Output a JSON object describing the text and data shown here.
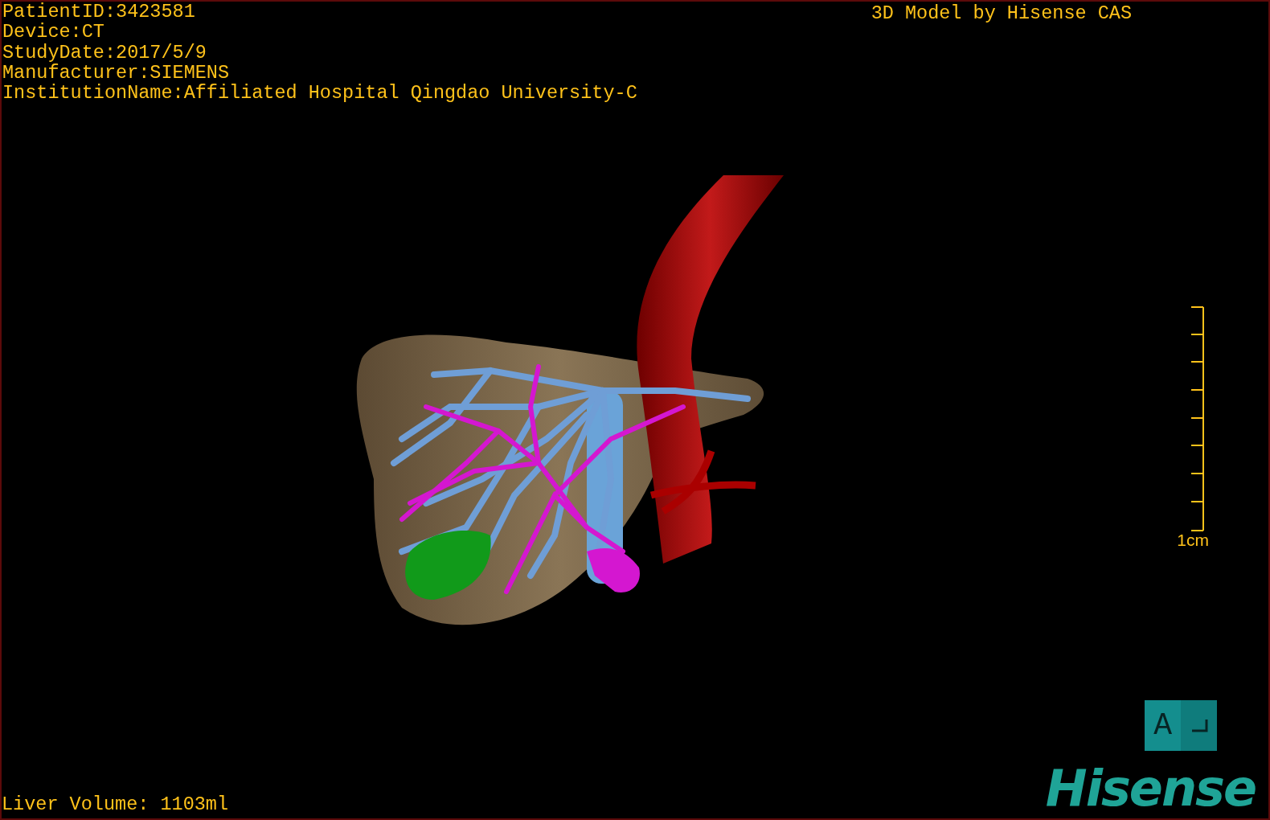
{
  "patient_info": [
    "PatientID:3423581",
    "Device:CT",
    "StudyDate:2017/5/9",
    "Manufacturer:SIEMENS",
    "InstitutionName:Affiliated Hospital Qingdao University-C"
  ],
  "title": "3D Model by Hisense CAS",
  "scale_bar": {
    "label": "1cm"
  },
  "liver_volume": "Liver Volume: 1103ml",
  "orientation_cube": {
    "label": "A"
  },
  "logo": "Hisense"
}
